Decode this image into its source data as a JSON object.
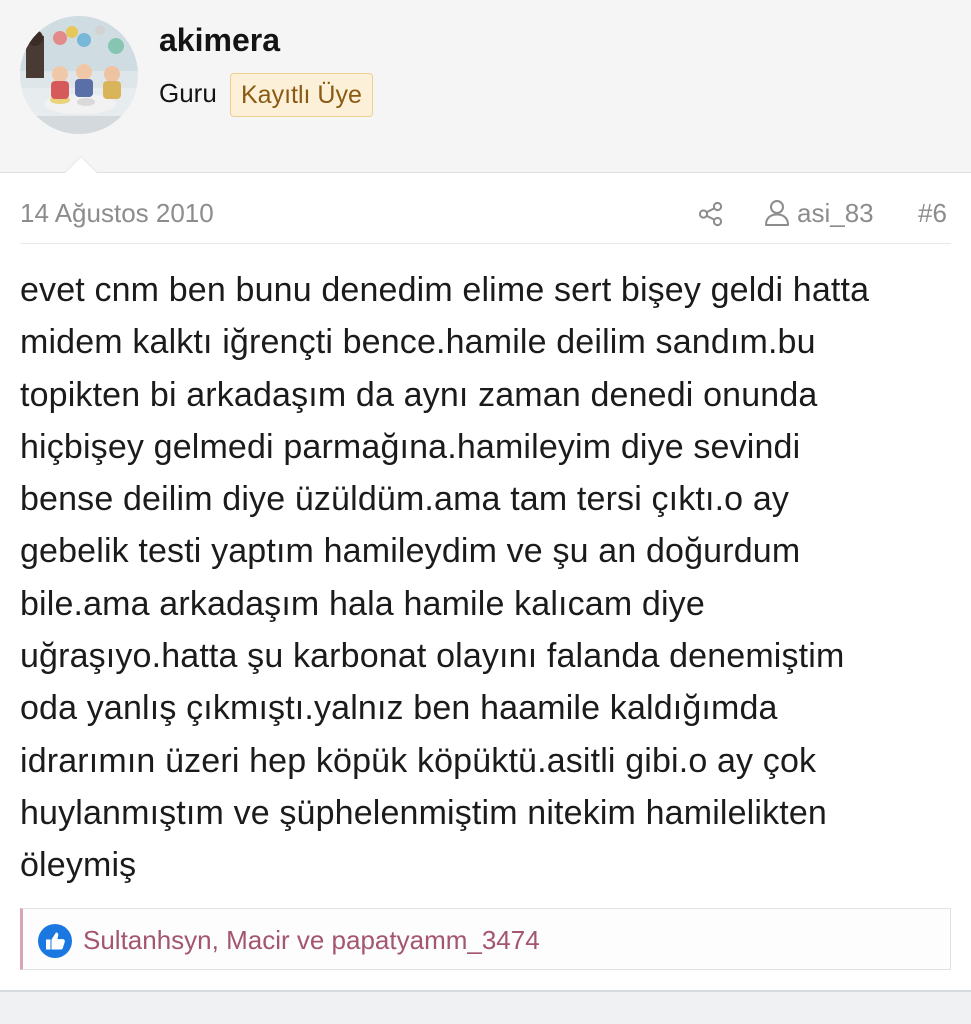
{
  "author": {
    "name": "akimera",
    "rank": "Guru",
    "badge": "Kayıtlı Üye"
  },
  "post": {
    "date": "14 Ağustos 2010",
    "share_icon": "share-icon",
    "user_icon": "user-icon",
    "reply_to_user": "asi_83",
    "number": "#6",
    "message": "evet cnm ben bunu denedim elime sert bişey geldi hatta\nmidem kalktı iğrençti bence.hamile deilim sandım.bu\ntopikten bi arkadaşım da aynı zaman denedi onunda\nhiçbişey gelmedi parmağına.hamileyim diye sevindi\nbense deilim diye üzüldüm.ama tam tersi çıktı.o ay\ngebelik testi yaptım hamileydim ve şu an doğurdum\nbile.ama arkadaşım hala hamile kalıcam diye\nuğraşıyo.hatta şu karbonat olayını falanda denemiştim\noda yanlış çıkmıştı.yalnız ben haamile kaldığımda\nidrarımın üzeri hep köpük köpüktü.asitli gibi.o ay çok\nhuylanmıştım ve şüphelenmiştim nitekim hamilelikten\nöleymiş"
  },
  "reactions": {
    "icon": "like-icon",
    "users": "Sultanhsyn, Macir ve papatyamm_3474"
  },
  "colors": {
    "badge_bg": "#fcf1d8",
    "badge_text": "#8a5a12",
    "reaction_text": "#a3566e",
    "like_blue": "#1a78e0",
    "muted_text": "#8c8c8c"
  }
}
